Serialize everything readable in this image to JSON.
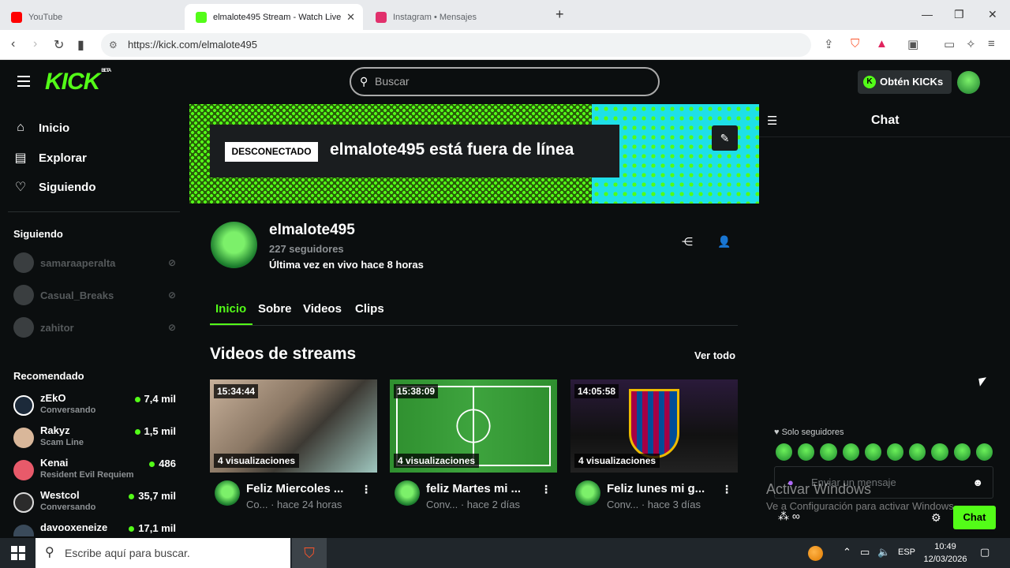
{
  "browser": {
    "tabs": [
      {
        "label": "YouTube",
        "color": "#ff0000"
      },
      {
        "label": "elmalote495 Stream - Watch Live",
        "color": "#53fc18"
      },
      {
        "label": "Instagram • Mensajes",
        "color": "#e1306c"
      }
    ],
    "new_tab": "+",
    "url": "https://kick.com/elmalote495"
  },
  "header": {
    "logo": "KICK",
    "logo_badge": "BETA",
    "search_placeholder": "Buscar",
    "kicks_button": "Obtén KICKs",
    "kicks_icon_letter": "K"
  },
  "sidebar": {
    "nav": [
      {
        "label": "Inicio",
        "icon": "home-icon"
      },
      {
        "label": "Explorar",
        "icon": "explore-icon"
      },
      {
        "label": "Siguiendo",
        "icon": "heart-icon"
      }
    ],
    "following_title": "Siguiendo",
    "following": [
      {
        "name": "samaraaperalta"
      },
      {
        "name": "Casual_Breaks"
      },
      {
        "name": "zahitor"
      }
    ],
    "recommended_title": "Recomendado",
    "recommended": [
      {
        "name": "zEkO",
        "category": "Conversando",
        "viewers": "7,4 mil",
        "color": "#1c2a3a"
      },
      {
        "name": "Rakyz",
        "category": "Scam Line",
        "viewers": "1,5 mil",
        "color": "#d9b79a"
      },
      {
        "name": "Kenai",
        "category": "Resident Evil Requiem",
        "viewers": "486",
        "color": "#e85a6a"
      },
      {
        "name": "Westcol",
        "category": "Conversando",
        "viewers": "35,7 mil",
        "color": "#2b2b2b"
      },
      {
        "name": "davooxeneize",
        "category": "",
        "viewers": "17,1 mil",
        "color": "#3a4a5a"
      }
    ]
  },
  "banner": {
    "badge": "DESCONECTADO",
    "text": "elmalote495 está fuera de línea"
  },
  "profile": {
    "name": "elmalote495",
    "followers": "227 seguidores",
    "last_live": "Última vez en vivo hace 8 horas",
    "tabs": [
      "Inicio",
      "Sobre",
      "Videos",
      "Clips"
    ]
  },
  "videos": {
    "section_title": "Videos de streams",
    "see_all": "Ver todo",
    "items": [
      {
        "duration": "15:34:44",
        "views": "4 visualizaciones",
        "title": "Feliz Miercoles ...",
        "category": "Co...",
        "time": "· hace 24 horas"
      },
      {
        "duration": "15:38:09",
        "views": "4 visualizaciones",
        "title": "feliz Martes mi ...",
        "category": "Conv...",
        "time": "· hace 2 días"
      },
      {
        "duration": "14:05:58",
        "views": "4 visualizaciones",
        "title": "Feliz lunes mi g...",
        "category": "Conv...",
        "time": "· hace 3 días"
      }
    ]
  },
  "chat": {
    "title": "Chat",
    "mode": "Solo seguidores",
    "input_placeholder": "Enviar un mensaje",
    "send_button": "Chat"
  },
  "watermark": {
    "line1": "Activar Windows",
    "line2": "Ve a Configuración para activar Windows."
  },
  "taskbar": {
    "search_placeholder": "Escribe aquí para buscar.",
    "language": "ESP",
    "time": "10:49",
    "date": "12/03/2026"
  }
}
